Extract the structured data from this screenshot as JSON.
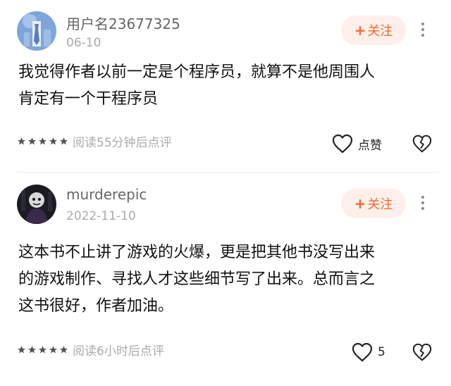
{
  "comments": [
    {
      "username": "用户名23677325",
      "date": "06-10",
      "follow_label": "关注",
      "follow_plus": "+",
      "text": "我觉得作者以前一定是个程序员，就算不是他周围人\n肯定有一个干程序员",
      "rating": 5,
      "read_note": "阅读55分钟后点评",
      "like_label": "点赞"
    },
    {
      "username": "murderepic",
      "date": "2022-11-10",
      "follow_label": "关注",
      "follow_plus": "+",
      "text": "这本书不止讲了游戏的火爆，更是把其他书没写出来\n的游戏制作、寻找人才这些细节写了出来。总而言之\n这书很好，作者加油。",
      "rating": 5,
      "read_note": "阅读6小时后点评",
      "like_label": "5"
    }
  ],
  "colors": {
    "accent": "#f26a2c",
    "follow_bg": "#fdf0ea",
    "muted": "#aaaaaa"
  },
  "icons": [
    "avatar-tie-icon",
    "avatar-dark-icon",
    "more-vertical-icon",
    "star-icon",
    "heart-outline-icon",
    "broken-heart-icon"
  ]
}
